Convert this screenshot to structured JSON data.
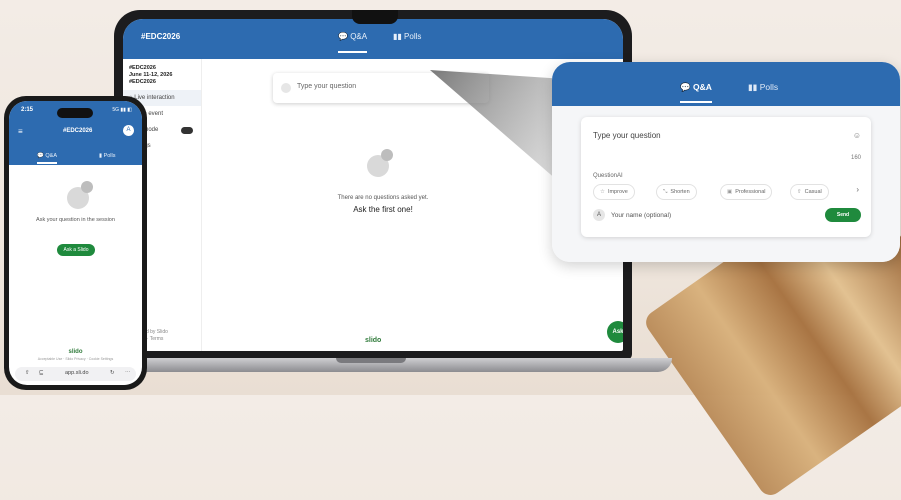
{
  "laptop": {
    "event_code": "#EDC2026",
    "tabs": {
      "qa": "Q&A",
      "polls": "Polls"
    },
    "sidebar": {
      "event_info": "#EDC2026\nJune 11-12, 2026\n#EDC2026",
      "nav": [
        "Live interaction",
        "Switch event",
        "Dark mode",
        "Settings"
      ],
      "footer": "Powered by Slido\nPrivacy · Terms"
    },
    "ask_placeholder": "Type your question",
    "empty_subtitle": "There are no questions asked yet.",
    "empty_title": "Ask the first one!",
    "brand": "slido",
    "fab_label": "Ask"
  },
  "phone": {
    "time": "2:15",
    "status": "5G ▮▮ ◧",
    "event_code": "#EDC2026",
    "avatar_letter": "A",
    "tabs": {
      "qa": "Q&A",
      "polls": "Polls"
    },
    "empty_text": "Ask your question in the session",
    "cta": "Ask a Slido",
    "brand": "slido",
    "fine_print": "Acceptable Use · Slido Privacy · Cookie Settings",
    "url": "app.sli.do"
  },
  "zoom": {
    "tabs": {
      "qa": "Q&A",
      "polls": "Polls"
    },
    "placeholder": "Type your question",
    "char_count": "160",
    "questionai_label": "QuestionAI",
    "chips": [
      "Improve",
      "Shorten",
      "Professional",
      "Casual"
    ],
    "name_placeholder": "Your name (optional)",
    "avatar_letter": "A",
    "send_label": "Send"
  },
  "colors": {
    "header_blue": "#2d6bb0",
    "brand_green": "#1f8a3d"
  }
}
